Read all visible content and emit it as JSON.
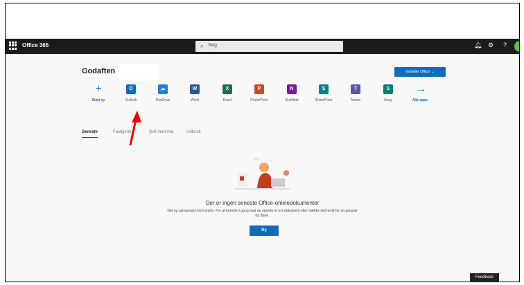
{
  "header": {
    "brand": "Office 365",
    "search_placeholder": "Søg"
  },
  "greeting": "Godaften",
  "install_button": "Installér Office ⌄",
  "apps": [
    {
      "label": "Start ny",
      "icon": "plus-icon",
      "color": "#0f6cbd",
      "glyph": "+"
    },
    {
      "label": "Outlook",
      "icon": "outlook-icon",
      "color": "#0f6cbd",
      "glyph": "O"
    },
    {
      "label": "OneDrive",
      "icon": "onedrive-icon",
      "color": "#1f7fd6",
      "glyph": "☁"
    },
    {
      "label": "Word",
      "icon": "word-icon",
      "color": "#2b5797",
      "glyph": "W"
    },
    {
      "label": "Excel",
      "icon": "excel-icon",
      "color": "#1e7145",
      "glyph": "X"
    },
    {
      "label": "PowerPoint",
      "icon": "powerpoint-icon",
      "color": "#d24726",
      "glyph": "P"
    },
    {
      "label": "OneNote",
      "icon": "onenote-icon",
      "color": "#7719aa",
      "glyph": "N"
    },
    {
      "label": "SharePoint",
      "icon": "sharepoint-icon",
      "color": "#038387",
      "glyph": "S"
    },
    {
      "label": "Teams",
      "icon": "teams-icon",
      "color": "#5558af",
      "glyph": "T"
    },
    {
      "label": "Sway",
      "icon": "sway-icon",
      "color": "#008272",
      "glyph": "S"
    },
    {
      "label": "Alle apps",
      "icon": "arrow-right-icon",
      "color": "#0f6cbd",
      "glyph": "→"
    }
  ],
  "tabs": [
    "Seneste",
    "Fastgjorte",
    "Delt med mig",
    "Udforsk"
  ],
  "empty_state": {
    "title": "Der er ingen seneste Office-onlinedokumenter",
    "description": "Del og samarbejd med andre. For at komme i gang skal du oprette et nyt dokument eller trække det hertil for at uploade og åbne.",
    "button": "Ny"
  },
  "feedback": "Feedback"
}
